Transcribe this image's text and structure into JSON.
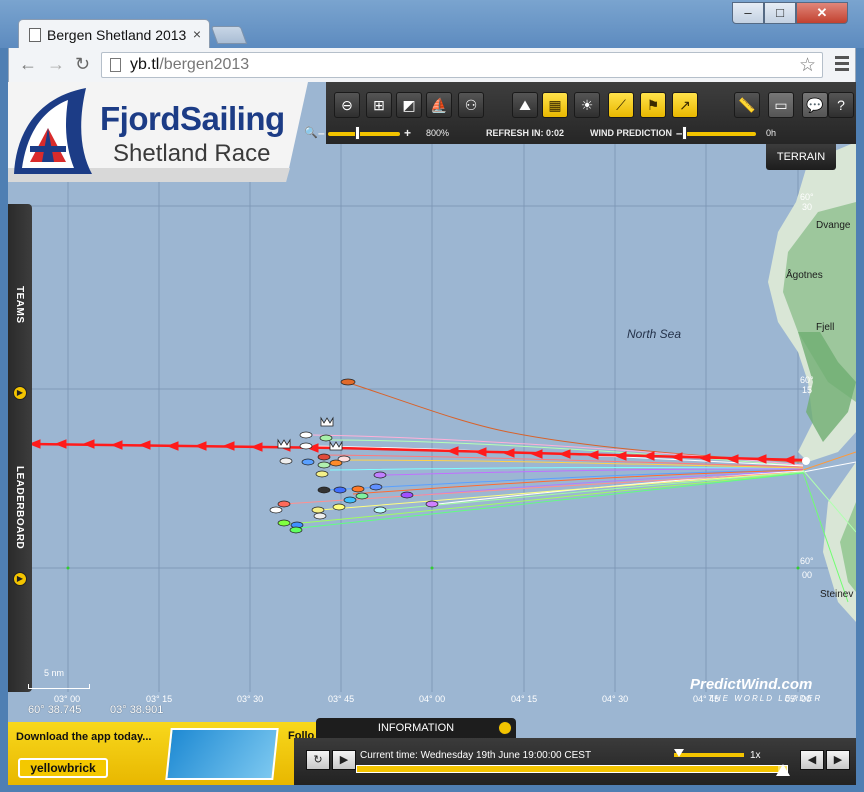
{
  "browser": {
    "tab_title": "Bergen Shetland 2013",
    "tab_close": "×",
    "url_host": "yb.tl",
    "url_path": "/bergen2013",
    "window_buttons": {
      "minimize": "–",
      "maximize": "□",
      "close": "✕"
    }
  },
  "header": {
    "brand_line1": "FjordSailing",
    "brand_line2": "Shetland Race"
  },
  "map_toolbar": {
    "zoom_label": "800%",
    "refresh_label": "REFRESH IN: 0:02",
    "wind_label": "WIND PREDICTION",
    "wind_value": "0h",
    "zoom_minus": "–",
    "zoom_plus": "+",
    "wind_minus": "–",
    "help_label": "?",
    "terrain_label": "TERRAIN",
    "zoom_level_pct": 42,
    "wind_level_pct": 5
  },
  "side_tabs": {
    "teams": "TEAMS",
    "leaderboard": "LEADERBOARD"
  },
  "map": {
    "sea_label": "North Sea",
    "places": [
      "Dvange",
      "Ågotnes",
      "Fjell",
      "Steinev"
    ],
    "lat_labels_right": [
      {
        "deg": "60°",
        "min": "30"
      },
      {
        "deg": "60°",
        "min": "15"
      },
      {
        "deg": "60°",
        "min": "00"
      }
    ],
    "lon_labels": [
      "03° 00",
      "03° 15",
      "03° 30",
      "03° 45",
      "04° 00",
      "04° 15",
      "04° 30",
      "04° 45",
      "05° 00"
    ],
    "cursor_coords": [
      "60° 38.745",
      "03° 38.901"
    ],
    "scale_label": "5 nm"
  },
  "branding": {
    "predictwind": "PredictWind.com",
    "predictwind_tag": "THE WORLD LEADER"
  },
  "promo": {
    "text": "Download the app today...",
    "button": "yellowbrick",
    "follow": "Follo"
  },
  "info_panel": {
    "tab_label": "INFORMATION"
  },
  "player": {
    "current_time": "Current time: Wednesday 19th June 19:00:00 CEST",
    "speed": "1x",
    "progress_pct": 98
  },
  "colors": {
    "accent_yellow": "#f3c400",
    "sea": "#9cb6d2",
    "rhumb_line": "#ff1b1b",
    "brand_blue": "#1c3c86"
  }
}
